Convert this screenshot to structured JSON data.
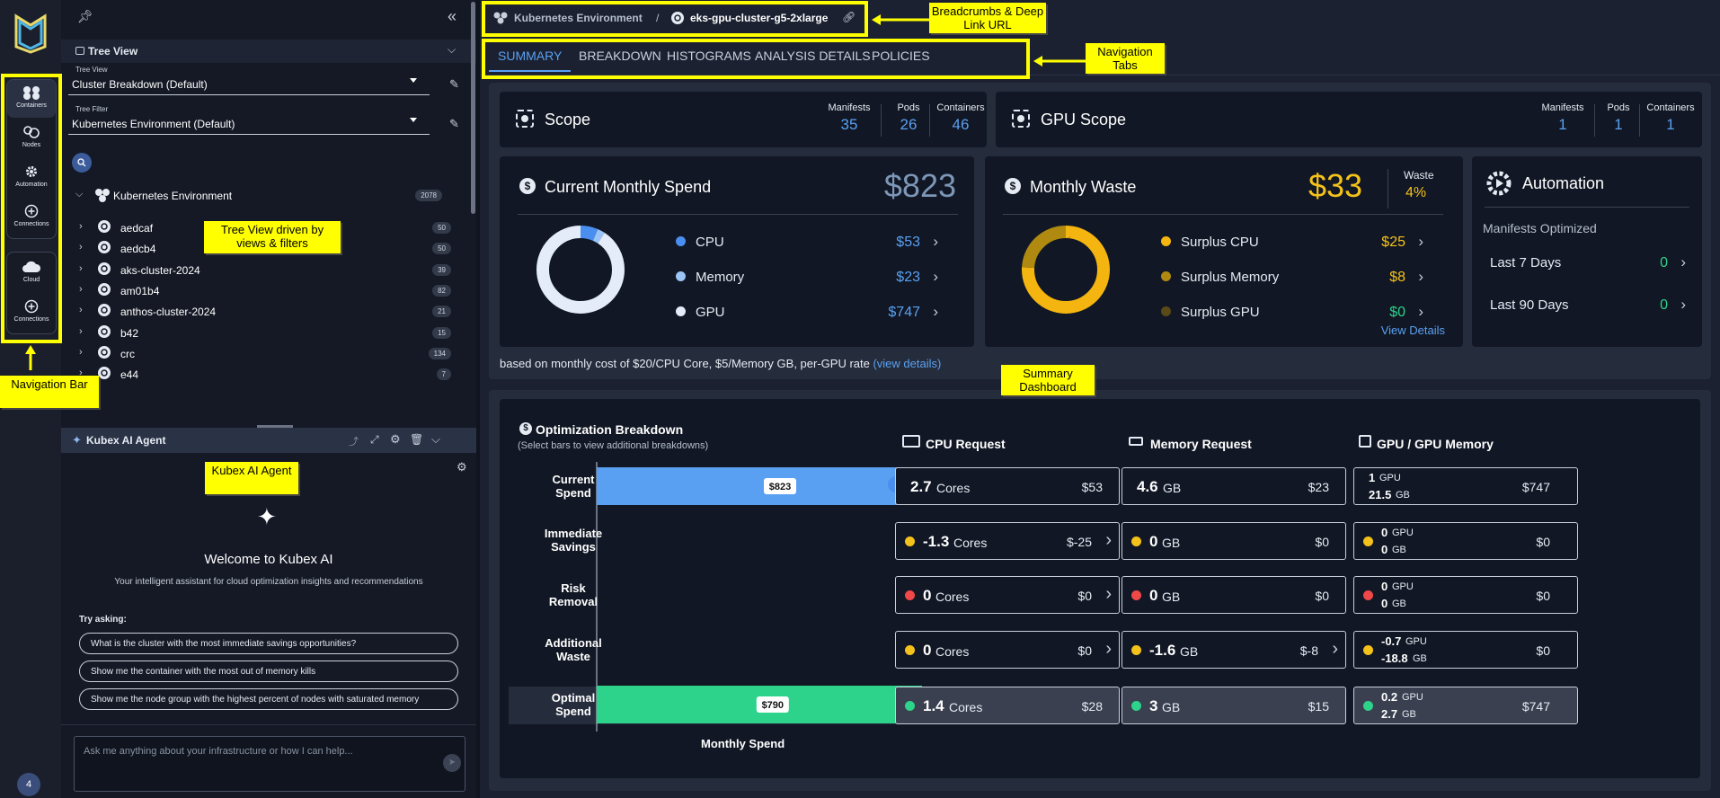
{
  "nav": {
    "items": [
      {
        "label": "Containers",
        "icon": "containers-icon"
      },
      {
        "label": "Nodes",
        "icon": "nodes-icon"
      },
      {
        "label": "Automation",
        "icon": "gear-icon"
      },
      {
        "label": "Connections",
        "icon": "plus-circle-icon"
      },
      {
        "label": "Cloud",
        "icon": "cloud-icon"
      },
      {
        "label": "Connections",
        "icon": "plus-circle-icon"
      }
    ],
    "badge": "4"
  },
  "tree": {
    "section_title": "Tree View",
    "view_label": "Tree View",
    "view_value": "Cluster Breakdown (Default)",
    "filter_label": "Tree Filter",
    "filter_value": "Kubernetes Environment (Default)",
    "root": {
      "label": "Kubernetes Environment",
      "count": "2078"
    },
    "items": [
      {
        "label": "aedcaf",
        "count": "50"
      },
      {
        "label": "aedcb4",
        "count": "50"
      },
      {
        "label": "aks-cluster-2024",
        "count": "39"
      },
      {
        "label": "am01b4",
        "count": "82"
      },
      {
        "label": "anthos-cluster-2024",
        "count": "21"
      },
      {
        "label": "b42",
        "count": "15"
      },
      {
        "label": "crc",
        "count": "134"
      },
      {
        "label": "e44",
        "count": "7"
      }
    ]
  },
  "agent": {
    "title": "Kubex AI Agent",
    "welcome": "Welcome to Kubex AI",
    "subtitle": "Your intelligent assistant for cloud optimization insights and recommendations",
    "try_label": "Try asking:",
    "suggestions": [
      "What is the cluster with the most immediate savings opportunities?",
      "Show me the container with the most out of memory kills",
      "Show me the node group with the highest percent of nodes with saturated memory"
    ],
    "input_placeholder": "Ask me anything about your infrastructure or how I can help..."
  },
  "breadcrumb": {
    "root": "Kubernetes Environment",
    "sep": "/",
    "current": "eks-gpu-cluster-g5-2xlarge"
  },
  "tabs": [
    "SUMMARY",
    "BREAKDOWN",
    "HISTOGRAMS",
    "ANALYSIS DETAILS",
    "POLICIES"
  ],
  "scope": {
    "title": "Scope",
    "stats": [
      {
        "label": "Manifests",
        "value": "35"
      },
      {
        "label": "Pods",
        "value": "26"
      },
      {
        "label": "Containers",
        "value": "46"
      }
    ]
  },
  "gpu_scope": {
    "title": "GPU Scope",
    "stats": [
      {
        "label": "Manifests",
        "value": "1"
      },
      {
        "label": "Pods",
        "value": "1"
      },
      {
        "label": "Containers",
        "value": "1"
      }
    ]
  },
  "spend": {
    "title": "Current Monthly Spend",
    "total": "$823",
    "items": [
      {
        "label": "CPU",
        "value": "$53",
        "color": "#4a8ff0"
      },
      {
        "label": "Memory",
        "value": "$23",
        "color": "#9cc4f6"
      },
      {
        "label": "GPU",
        "value": "$747",
        "color": "#e3ecf8"
      }
    ]
  },
  "waste": {
    "title": "Monthly Waste",
    "total": "$33",
    "pct_label": "Waste",
    "pct": "4%",
    "items": [
      {
        "label": "Surplus CPU",
        "value": "$25",
        "color": "#f5b510"
      },
      {
        "label": "Surplus Memory",
        "value": "$8",
        "color": "#b08a10"
      },
      {
        "label": "Surplus GPU",
        "value": "$0",
        "color": "#5a4a18"
      }
    ],
    "link": "View Details"
  },
  "automation": {
    "title": "Automation",
    "subtitle": "Manifests Optimized",
    "rows": [
      {
        "label": "Last 7 Days",
        "value": "0"
      },
      {
        "label": "Last 90 Days",
        "value": "0"
      }
    ]
  },
  "cost_note": {
    "text": "based on monthly cost of $20/CPU Core, $5/Memory GB, per-GPU rate",
    "link": "(view details)"
  },
  "breakdown": {
    "title": "Optimization Breakdown",
    "hint": "(Select bars to view additional breakdowns)",
    "xlabel": "Monthly Spend",
    "headers": {
      "cpu": "CPU Request",
      "mem": "Memory Request",
      "gpu": "GPU / GPU Memory"
    },
    "rows": [
      {
        "label1": "Current",
        "label2": "Spend",
        "bar": "$823",
        "cpu": "2.7",
        "cpu_unit": "Cores",
        "cpu_cost": "$53",
        "mem": "4.6",
        "mem_unit": "GB",
        "mem_cost": "$23",
        "gpu1": "1",
        "gpu1u": "GPU",
        "gpu2": "21.5",
        "gpu2u": "GB",
        "gpu_cost": "$747"
      },
      {
        "label1": "Immediate",
        "label2": "Savings",
        "bar": "← $-25",
        "cpu": "-1.3",
        "cpu_unit": "Cores",
        "cpu_cost": "$-25",
        "mem": "0",
        "mem_unit": "GB",
        "mem_cost": "$0",
        "gpu1": "0",
        "gpu1u": "GPU",
        "gpu2": "0",
        "gpu2u": "GB",
        "gpu_cost": "$0"
      },
      {
        "label1": "Risk",
        "label2": "Removal",
        "bar": "$0 →",
        "cpu": "0",
        "cpu_unit": "Cores",
        "cpu_cost": "$0",
        "mem": "0",
        "mem_unit": "GB",
        "mem_cost": "$0",
        "gpu1": "0",
        "gpu1u": "GPU",
        "gpu2": "0",
        "gpu2u": "GB",
        "gpu_cost": "$0"
      },
      {
        "label1": "Additional",
        "label2": "Waste",
        "bar": "← $-8",
        "cpu": "0",
        "cpu_unit": "Cores",
        "cpu_cost": "$0",
        "mem": "-1.6",
        "mem_unit": "GB",
        "mem_cost": "$-8",
        "gpu1": "-0.7",
        "gpu1u": "GPU",
        "gpu2": "-18.8",
        "gpu2u": "GB",
        "gpu_cost": "$0"
      },
      {
        "label1": "Optimal",
        "label2": "Spend",
        "bar": "$790",
        "cpu": "1.4",
        "cpu_unit": "Cores",
        "cpu_cost": "$28",
        "mem": "3",
        "mem_unit": "GB",
        "mem_cost": "$15",
        "gpu1": "0.2",
        "gpu1u": "GPU",
        "gpu2": "2.7",
        "gpu2u": "GB",
        "gpu_cost": "$747"
      }
    ]
  },
  "chart_data": {
    "type": "bar",
    "categories": [
      "Current Spend",
      "Immediate Savings",
      "Risk Removal",
      "Additional Waste",
      "Optimal Spend"
    ],
    "values": [
      823,
      -25,
      0,
      -8,
      790
    ],
    "xlabel": "Monthly Spend"
  },
  "annotations": {
    "breadcrumbs": "Breadcrumbs & Deep Link URL",
    "tabs": "Navigation Tabs",
    "tree": "Tree View driven by views & filters",
    "nav": "Navigation Bar",
    "agent": "Kubex AI Agent",
    "summary": "Summary Dashboard"
  }
}
